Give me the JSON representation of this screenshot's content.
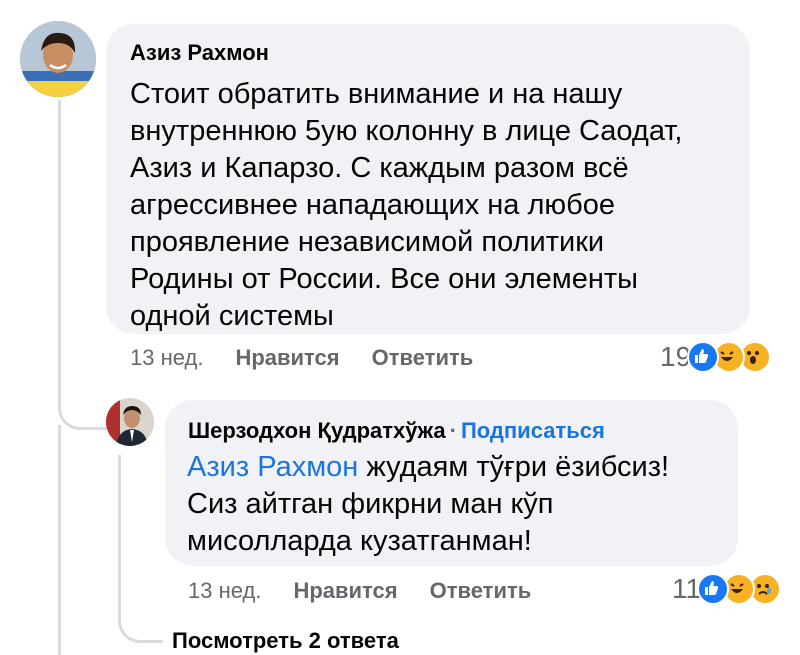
{
  "comment": {
    "author": "Азиз Рахмон",
    "lines": [
      "Стоит обратить внимание и на нашу",
      "внутреннюю 5ую колонну в лице Саодат,",
      "Азиз и Капарзо. С каждым разом всё",
      "агрессивнее нападающих на любое",
      "проявление независимой политики",
      "Родины от России. Все они элементы",
      "одной системы"
    ],
    "time": "13 нед.",
    "like_label": "Нравится",
    "reply_label": "Ответить",
    "reaction_count": "19",
    "reactions": [
      "like-icon",
      "haha-icon",
      "wow-icon"
    ]
  },
  "reply": {
    "author": "Шерзодхон Қудратхўжа",
    "separator": "·",
    "subscribe_label": "Подписаться",
    "mention": "Азиз Рахмон",
    "line1_rest": " жудаям тўғри ёзибсиз!",
    "line2": "Сиз айтган фикрни ман кўп",
    "line3": "мисолларда кузатганман!",
    "time": "13 нед.",
    "like_label": "Нравится",
    "reply_label": "Ответить",
    "reaction_count": "11",
    "reactions": [
      "like-icon",
      "haha-icon",
      "sad-icon"
    ]
  },
  "view_replies": "Посмотреть 2 ответа",
  "colors": {
    "link": "#1b74e4",
    "bubble": "#f0f2f5",
    "secondary_text": "#65676b",
    "like": "#1877f2",
    "emoji": "#f7b125"
  }
}
